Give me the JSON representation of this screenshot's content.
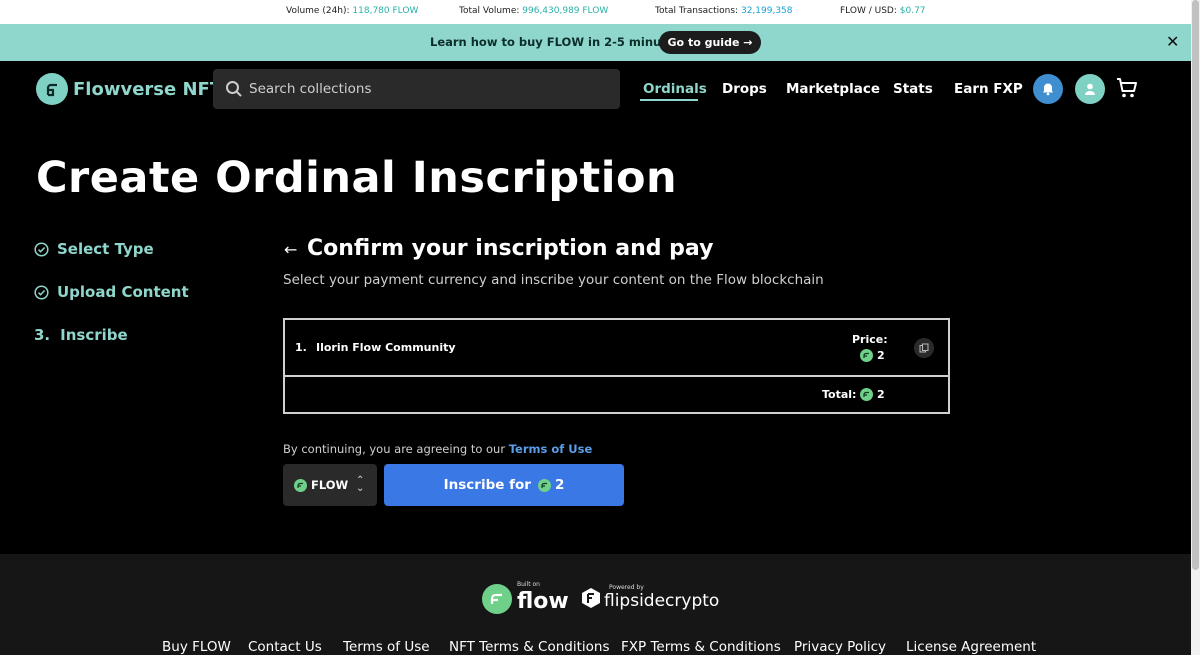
{
  "stats": {
    "volume_24h_label": "Volume (24h):",
    "volume_24h_value": "118,780 FLOW",
    "total_volume_label": "Total Volume:",
    "total_volume_value": "996,430,989 FLOW",
    "total_tx_label": "Total Transactions:",
    "total_tx_value": "32,199,358",
    "price_label": "FLOW / USD:",
    "price_value": "$0.77"
  },
  "announcement": {
    "text": "Learn how to buy FLOW in 2-5 minutes",
    "button_label": "Go to guide →"
  },
  "header": {
    "logo_text": "Flowverse NFT",
    "search_placeholder": "Search collections",
    "nav": {
      "ordinals": "Ordinals",
      "drops": "Drops",
      "marketplace": "Marketplace",
      "stats": "Stats",
      "earn": "Earn FXP"
    }
  },
  "page": {
    "title": "Create Ordinal Inscription"
  },
  "steps": {
    "step1": "Select Type",
    "step2": "Upload Content",
    "step3_num": "3.",
    "step3": "Inscribe"
  },
  "main": {
    "title": "Confirm your inscription and pay",
    "subtitle": "Select your payment currency and inscribe your content on the Flow blockchain",
    "item": {
      "number": "1.",
      "name": "Ilorin Flow Community",
      "price_label": "Price:",
      "price_value": "2"
    },
    "total_label": "Total:",
    "total_value": "2",
    "terms_prefix": "By continuing, you are agreeing to our ",
    "terms_link": "Terms of Use",
    "currency": "FLOW",
    "inscribe_label": "Inscribe for",
    "inscribe_value": "2"
  },
  "footer": {
    "built_on_small": "Built on",
    "built_on_big": "flow",
    "powered_small": "Powered by",
    "powered_big": "flipsidecrypto",
    "links": {
      "buy": "Buy FLOW",
      "contact": "Contact Us",
      "terms": "Terms of Use",
      "nft_terms": "NFT Terms & Conditions",
      "fxp_terms": "FXP Terms & Conditions",
      "privacy": "Privacy Policy",
      "license": "License Agreement"
    }
  },
  "colors": {
    "accent": "#8fd6cc",
    "primary_button": "#3a78e6",
    "flow_green": "#6fd08a",
    "link_blue": "#5a9ee8"
  }
}
